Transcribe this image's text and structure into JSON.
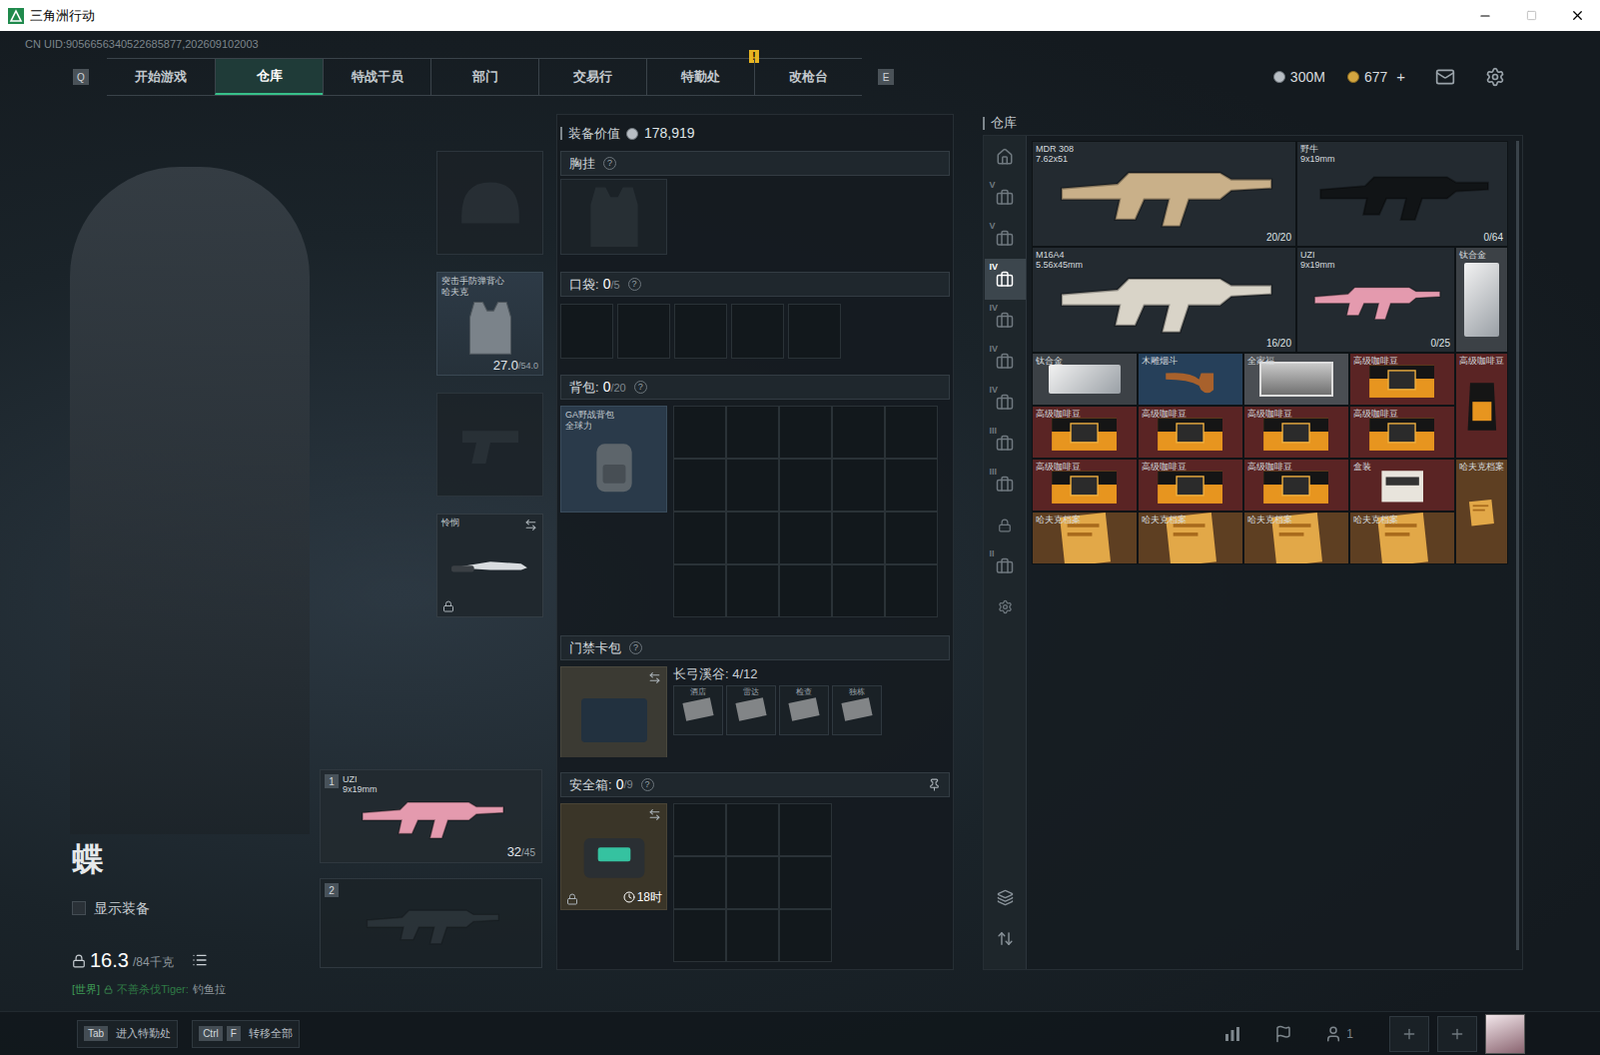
{
  "window": {
    "title": "三角洲行动",
    "uid": "CN UID:9056656340522685877,202609102003"
  },
  "nav": {
    "prev_key": "Q",
    "next_key": "E",
    "tabs": [
      {
        "label": "开始游戏",
        "selected": false,
        "badge": ""
      },
      {
        "label": "仓库",
        "selected": true,
        "badge": ""
      },
      {
        "label": "特战干员",
        "selected": false,
        "badge": ""
      },
      {
        "label": "部门",
        "selected": false,
        "badge": ""
      },
      {
        "label": "交易行",
        "selected": false,
        "badge": ""
      },
      {
        "label": "特勤处",
        "selected": false,
        "badge": "!"
      },
      {
        "label": "改枪台",
        "selected": false,
        "badge": ""
      }
    ]
  },
  "currency": {
    "silver": "300M",
    "gold": "677",
    "gold_add": "+"
  },
  "character": {
    "name": "蝶",
    "show_gear_label": "显示装备",
    "show_gear_checked": false,
    "weight": "16.3",
    "weight_max": "/84千克"
  },
  "chat": {
    "channel": "[世界]",
    "sender": "不善杀伐Tiger:",
    "message": "钓鱼拉"
  },
  "gear": {
    "helmet": {
      "empty": true
    },
    "armor": {
      "name": "突击手防弹背心",
      "sub": "哈夫克",
      "durability": "27.0",
      "max": "/54.0"
    },
    "pistol": {
      "empty": true
    },
    "melee": {
      "name": "怜悯",
      "locked": true
    }
  },
  "weapons": [
    {
      "index": "1",
      "name": "UZI",
      "caliber": "9x19mm",
      "ammo": "32",
      "capacity": "/45",
      "empty": false
    },
    {
      "index": "2",
      "empty": true
    }
  ],
  "loadout": {
    "value_label": "装备价值",
    "value": "178,919",
    "chest_rig": {
      "title": "胸挂",
      "help": "?",
      "empty": true
    },
    "pockets": {
      "title": "口袋:",
      "count": "0",
      "capacity": "/5",
      "help": "?",
      "slots": 5
    },
    "backpack": {
      "title": "背包:",
      "count": "0",
      "capacity": "/20",
      "help": "?",
      "item_name": "GA野战背包",
      "item_sub": "全球力",
      "cells": 20
    },
    "keycard_case": {
      "title": "门禁卡包",
      "help": "?",
      "map": "长弓溪谷: 4/12",
      "cards": [
        "酒店",
        "雷达",
        "检查",
        "独栋"
      ]
    },
    "safe_box": {
      "title": "安全箱:",
      "count": "0",
      "capacity": "/9",
      "help": "?",
      "timer": "18时",
      "locked": true,
      "cells": 9
    }
  },
  "warehouse": {
    "title": "仓库",
    "tabs": [
      {
        "kind": "home",
        "selected": false
      },
      {
        "kind": "case",
        "label": "V",
        "selected": false
      },
      {
        "kind": "case",
        "label": "V",
        "selected": false
      },
      {
        "kind": "case",
        "label": "IV",
        "selected": true
      },
      {
        "kind": "case",
        "label": "IV",
        "selected": false
      },
      {
        "kind": "case",
        "label": "IV",
        "selected": false
      },
      {
        "kind": "case",
        "label": "IV",
        "selected": false
      },
      {
        "kind": "case",
        "label": "III",
        "selected": false
      },
      {
        "kind": "case",
        "label": "III",
        "selected": false
      },
      {
        "kind": "lock",
        "selected": false
      },
      {
        "kind": "case",
        "label": "II",
        "selected": false
      },
      {
        "kind": "gear",
        "selected": false
      }
    ],
    "items": [
      {
        "name": "MDR 308",
        "sub": "7.62x51",
        "ammo": "20/20",
        "kind": "weapon",
        "color": "#232a30"
      },
      {
        "name": "野牛",
        "sub": "9x19mm",
        "ammo": "0/64",
        "kind": "weapon",
        "color": "#232a30"
      },
      {
        "name": "M16A4",
        "sub": "5.56x45mm",
        "ammo": "16/20",
        "kind": "weapon",
        "color": "#232a30"
      },
      {
        "name": "UZI",
        "sub": "9x19mm",
        "ammo": "0/25",
        "kind": "weapon",
        "color": "#232a30"
      },
      {
        "name": "钛合金",
        "kind": "plate",
        "color": "#3c4146"
      },
      {
        "name": "钛合金",
        "kind": "plate",
        "color": "#3c4146"
      },
      {
        "name": "木雕烟斗",
        "kind": "pipe",
        "color": "#26405a"
      },
      {
        "name": "全家福",
        "kind": "photo",
        "color": "#4a4e53"
      },
      {
        "name": "高级咖啡豆",
        "kind": "coffee",
        "color": "#5a2424"
      },
      {
        "name": "高级咖啡豆",
        "kind": "coffee_bag",
        "color": "#5a2424"
      },
      {
        "name": "高级咖啡豆",
        "kind": "coffee",
        "color": "#5a2424"
      },
      {
        "name": "高级咖啡豆",
        "kind": "coffee",
        "color": "#5a2424"
      },
      {
        "name": "高级咖啡豆",
        "kind": "coffee",
        "color": "#5a2424"
      },
      {
        "name": "高级咖啡豆",
        "kind": "coffee",
        "color": "#5a2424"
      },
      {
        "name": "高级咖啡豆",
        "kind": "coffee",
        "color": "#5a2424"
      },
      {
        "name": "高级咖啡豆",
        "kind": "coffee",
        "color": "#5a2424"
      },
      {
        "name": "高级咖啡豆",
        "kind": "coffee",
        "color": "#5a2424"
      },
      {
        "name": "盒装",
        "kind": "milk",
        "color": "#5a2424"
      },
      {
        "name": "哈夫克档案",
        "kind": "file",
        "color": "#5e3f22"
      },
      {
        "name": "哈夫克档案",
        "kind": "file",
        "color": "#5e3f22"
      },
      {
        "name": "哈夫克档案",
        "kind": "file",
        "color": "#5e3f22"
      },
      {
        "name": "哈夫克档案",
        "kind": "file",
        "color": "#5e3f22"
      },
      {
        "name": "哈夫克档案",
        "kind": "file",
        "color": "#5e3f22"
      }
    ]
  },
  "bottom": {
    "hints": [
      {
        "keys": [
          "Tab"
        ],
        "label": "进入特勤处"
      },
      {
        "keys": [
          "Ctrl",
          "F"
        ],
        "label": "转移全部"
      }
    ],
    "online": "1"
  }
}
